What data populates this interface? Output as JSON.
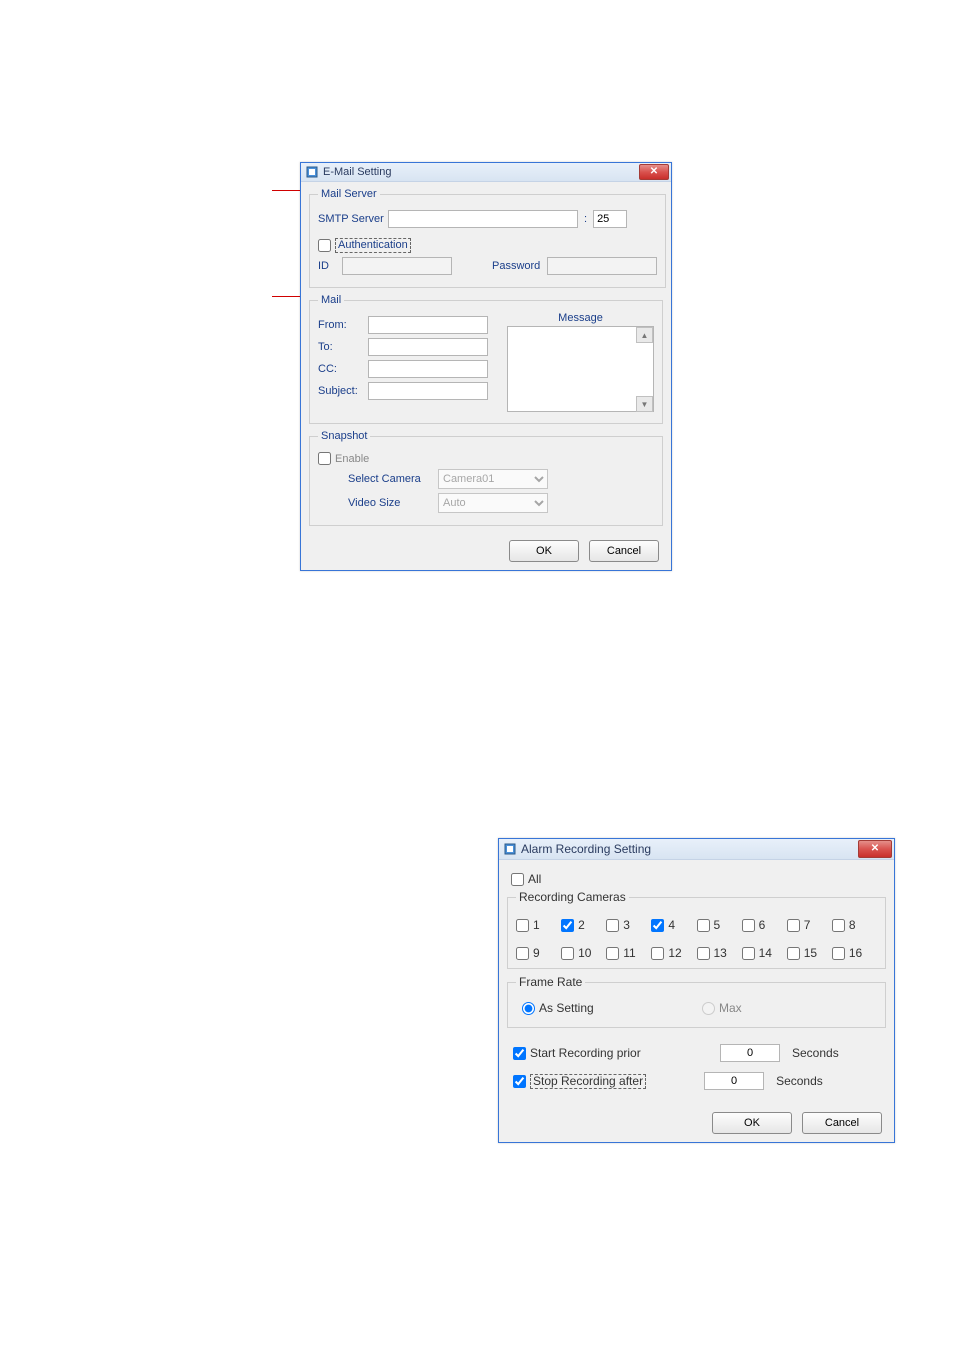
{
  "email_dialog": {
    "title": "E-Mail Setting",
    "groups": {
      "mail_server": {
        "legend": "Mail Server",
        "smtp_label": "SMTP Server",
        "smtp_value": "",
        "port_sep": ":",
        "port_value": "25",
        "auth_checkbox_label": "Authentication",
        "auth_checked": false,
        "id_label": "ID",
        "id_value": "",
        "password_label": "Password",
        "password_value": ""
      },
      "mail": {
        "legend": "Mail",
        "message_label": "Message",
        "from_label": "From:",
        "from_value": "",
        "to_label": "To:",
        "to_value": "",
        "cc_label": "CC:",
        "cc_value": "",
        "subject_label": "Subject:",
        "subject_value": "",
        "message_value": ""
      },
      "snapshot": {
        "legend": "Snapshot",
        "enable_label": "Enable",
        "enable_checked": false,
        "select_camera_label": "Select Camera",
        "select_camera_value": "Camera01",
        "video_size_label": "Video Size",
        "video_size_value": "Auto"
      }
    },
    "buttons": {
      "ok": "OK",
      "cancel": "Cancel"
    }
  },
  "alarm_dialog": {
    "title": "Alarm Recording Setting",
    "all_label": "All",
    "all_checked": false,
    "recording_cameras": {
      "legend": "Recording Cameras",
      "cameras": [
        {
          "n": "1",
          "checked": false
        },
        {
          "n": "2",
          "checked": true
        },
        {
          "n": "3",
          "checked": false
        },
        {
          "n": "4",
          "checked": true
        },
        {
          "n": "5",
          "checked": false
        },
        {
          "n": "6",
          "checked": false
        },
        {
          "n": "7",
          "checked": false
        },
        {
          "n": "8",
          "checked": false
        },
        {
          "n": "9",
          "checked": false
        },
        {
          "n": "10",
          "checked": false
        },
        {
          "n": "11",
          "checked": false
        },
        {
          "n": "12",
          "checked": false
        },
        {
          "n": "13",
          "checked": false
        },
        {
          "n": "14",
          "checked": false
        },
        {
          "n": "15",
          "checked": false
        },
        {
          "n": "16",
          "checked": false
        }
      ]
    },
    "frame_rate": {
      "legend": "Frame Rate",
      "as_setting_label": "As Setting",
      "max_label": "Max",
      "selected": "as_setting"
    },
    "start_label": "Start Recording prior",
    "start_checked": true,
    "start_value": "0",
    "stop_label": "Stop Recording after",
    "stop_checked": true,
    "stop_value": "0",
    "seconds_label": "Seconds",
    "buttons": {
      "ok": "OK",
      "cancel": "Cancel"
    }
  }
}
